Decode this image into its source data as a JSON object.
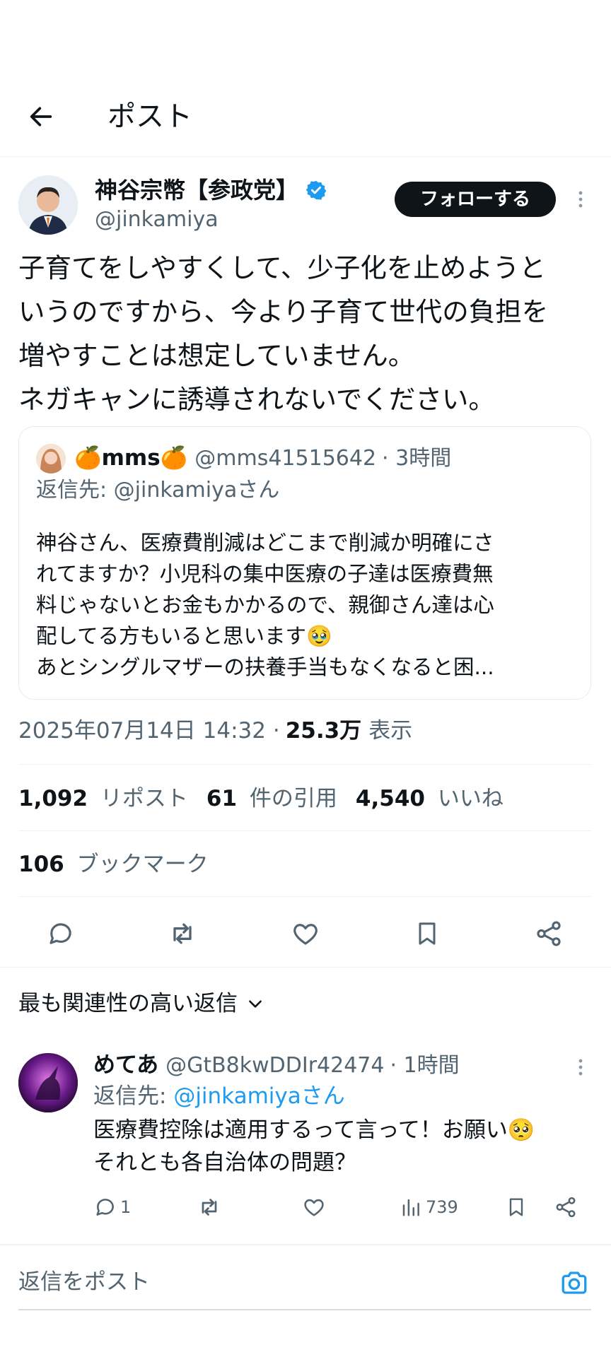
{
  "header": {
    "title": "ポスト"
  },
  "post": {
    "author_name": "神谷宗幣【参政党】",
    "author_handle": "@jinkamiya",
    "follow_label": "フォローする",
    "text_lines": [
      "子育てをしやすくして、少子化を止めようと",
      "いうのですから、今より子育て世代の負担を",
      "増やすことは想定していません。",
      "ネガキャンに誘導されないでください。"
    ],
    "quote": {
      "name": "🍊mms🍊",
      "handle": "@mms41515642",
      "time": "· 3時間",
      "reply_to": "返信先: @jinkamiyaさん",
      "text_lines": [
        "神谷さん、医療費削減はどこまで削減か明確にさ",
        "れてますか？小児科の集中医療の子達は医療費無",
        "料じゃないとお金もかかるので、親御さん達は心",
        "配してる方もいると思います🥹",
        "あとシングルマザーの扶養手当もなくなると困..."
      ]
    },
    "timestamp": "2025年07月14日 14:32 ·",
    "views_value": "25.3万",
    "views_label": "表示",
    "stats": {
      "reposts_value": "1,092",
      "reposts_label": "リポスト",
      "quotes_value": "61",
      "quotes_label": "件の引用",
      "likes_value": "4,540",
      "likes_label": "いいね",
      "bookmarks_value": "106",
      "bookmarks_label": "ブックマーク"
    }
  },
  "replies_section": {
    "sort_label": "最も関連性の高い返信"
  },
  "reply": {
    "name": "めてあ",
    "handle": "@GtB8kwDDIr42474",
    "time": "· 1時間",
    "reply_prefix": "返信先: ",
    "reply_mention": "@jinkamiyaさん",
    "text_lines": [
      "医療費控除は適用するって言って！お願い🥺",
      "それとも各自治体の問題？"
    ],
    "reply_count": "1",
    "views_count": "739"
  },
  "composer": {
    "placeholder": "返信をポスト"
  },
  "colors": {
    "accent": "#1d9bf0",
    "text": "#0f1419",
    "muted": "#536471",
    "border": "#eff3f4"
  }
}
